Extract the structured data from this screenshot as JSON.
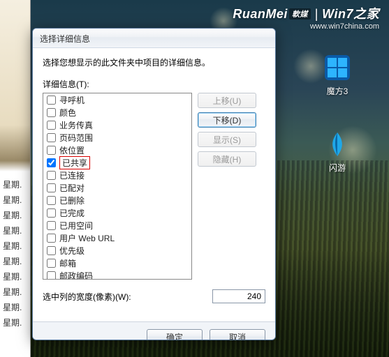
{
  "watermark": {
    "brand": "RuanMei",
    "brand_cn": "軟媒",
    "title": "Win7之家",
    "url": "www.win7china.com"
  },
  "desktop": {
    "icon1": "魔方3",
    "icon2": "闪游"
  },
  "leftStrip": {
    "label": "星期."
  },
  "dialog": {
    "title": "选择详细信息",
    "instruction": "选择您想显示的此文件夹中项目的详细信息。",
    "sectionLabel": "详细信息(T):",
    "items": [
      {
        "label": "寻呼机",
        "checked": false
      },
      {
        "label": "颜色",
        "checked": false
      },
      {
        "label": "业务传真",
        "checked": false
      },
      {
        "label": "页码范围",
        "checked": false
      },
      {
        "label": "依位置",
        "checked": false
      },
      {
        "label": "已共享",
        "checked": true,
        "highlight": true
      },
      {
        "label": "已连接",
        "checked": false
      },
      {
        "label": "已配对",
        "checked": false
      },
      {
        "label": "已删除",
        "checked": false
      },
      {
        "label": "已完成",
        "checked": false
      },
      {
        "label": "已用空间",
        "checked": false
      },
      {
        "label": "用户 Web URL",
        "checked": false
      },
      {
        "label": "优先级",
        "checked": false
      },
      {
        "label": "邮箱",
        "checked": false
      },
      {
        "label": "邮政编码",
        "checked": false
      }
    ],
    "buttons": {
      "moveUp": "上移(U)",
      "moveDown": "下移(D)",
      "show": "显示(S)",
      "hide": "隐藏(H)"
    },
    "widthLabel": "选中列的宽度(像素)(W):",
    "widthValue": "240",
    "ok": "确定",
    "cancel": "取消"
  }
}
